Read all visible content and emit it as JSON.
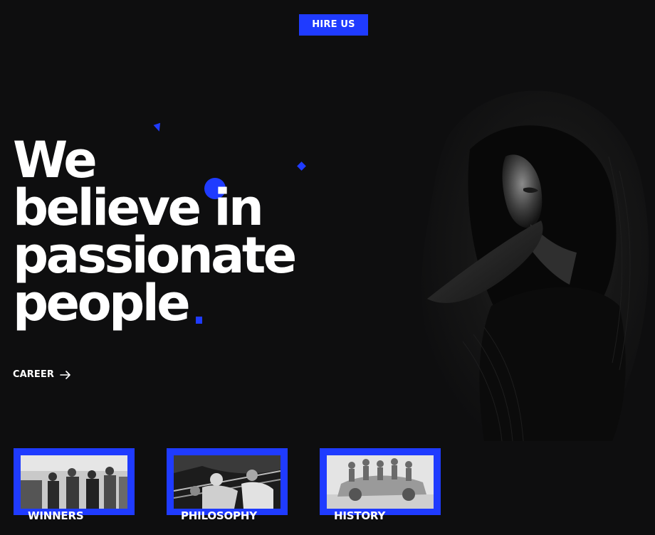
{
  "header": {
    "hire_label": "HIRE US"
  },
  "hero": {
    "headline_lines": [
      "We",
      "believe in",
      "passionate",
      "people"
    ]
  },
  "career": {
    "label": "CAREER",
    "icon": "arrow-right-icon"
  },
  "cards": [
    {
      "label": "WINNERS",
      "image": "street-crowd-photo"
    },
    {
      "label": "PHILOSOPHY",
      "image": "boxing-photo"
    },
    {
      "label": "HISTORY",
      "image": "sculpture-car-photo"
    }
  ],
  "colors": {
    "accent": "#1f3bff",
    "background": "#0e0e0f",
    "text": "#ffffff"
  }
}
